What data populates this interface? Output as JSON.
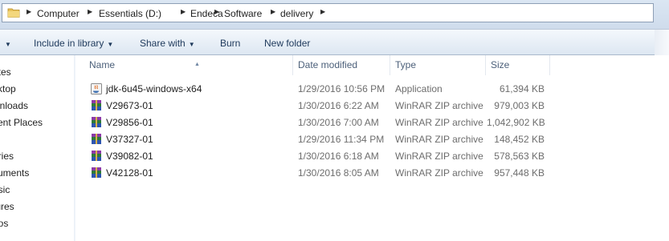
{
  "address": {
    "crumbs": [
      "Computer",
      "Essentials (D:)",
      "Endeca",
      "Software",
      "delivery"
    ]
  },
  "toolbar": {
    "organize_partial": "",
    "include_in_library": "Include in library",
    "share_with": "Share with",
    "burn": "Burn",
    "new_folder": "New folder"
  },
  "nav": {
    "items": [
      "rites",
      "sktop",
      "wnloads",
      "cent Places",
      "",
      "aries",
      "cuments",
      "usic",
      "tures",
      "eos"
    ]
  },
  "columns": {
    "name": "Name",
    "date": "Date modified",
    "type": "Type",
    "size": "Size"
  },
  "files": [
    {
      "name": "jdk-6u45-windows-x64",
      "date": "1/29/2016 10:56 PM",
      "type": "Application",
      "size": "61,394 KB",
      "icon": "java-installer-icon"
    },
    {
      "name": "V29673-01",
      "date": "1/30/2016 6:22 AM",
      "type": "WinRAR ZIP archive",
      "size": "979,003 KB",
      "icon": "winrar-archive-icon"
    },
    {
      "name": "V29856-01",
      "date": "1/30/2016 7:00 AM",
      "type": "WinRAR ZIP archive",
      "size": "1,042,902 KB",
      "icon": "winrar-archive-icon"
    },
    {
      "name": "V37327-01",
      "date": "1/29/2016 11:34 PM",
      "type": "WinRAR ZIP archive",
      "size": "148,452 KB",
      "icon": "winrar-archive-icon"
    },
    {
      "name": "V39082-01",
      "date": "1/30/2016 6:18 AM",
      "type": "WinRAR ZIP archive",
      "size": "578,563 KB",
      "icon": "winrar-archive-icon"
    },
    {
      "name": "V42128-01",
      "date": "1/30/2016 8:05 AM",
      "type": "WinRAR ZIP archive",
      "size": "957,448 KB",
      "icon": "winrar-archive-icon"
    }
  ]
}
